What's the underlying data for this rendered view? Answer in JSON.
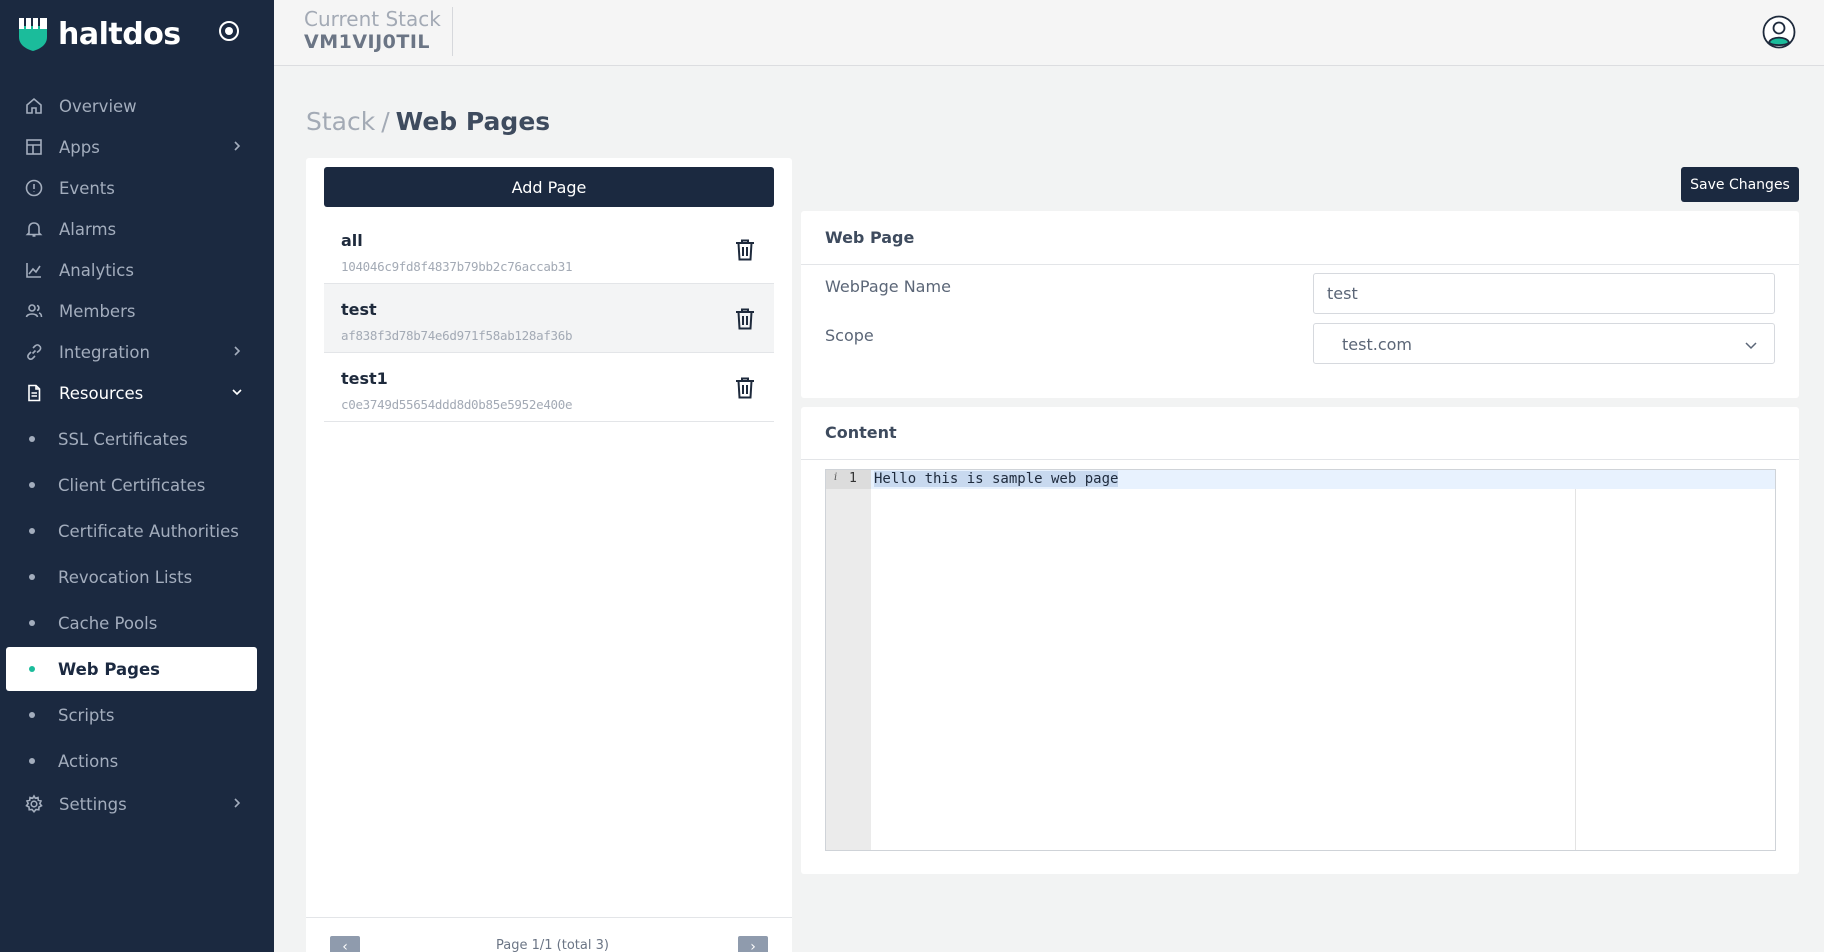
{
  "brand": {
    "name": "haltdos"
  },
  "topbar": {
    "stack_label": "Current Stack",
    "stack_value": "VM1VIJ0TIL"
  },
  "sidebar": {
    "items": [
      {
        "label": "Overview",
        "icon": "home-icon"
      },
      {
        "label": "Apps",
        "icon": "layout-icon"
      },
      {
        "label": "Events",
        "icon": "alert-circle-icon"
      },
      {
        "label": "Alarms",
        "icon": "bell-icon"
      },
      {
        "label": "Analytics",
        "icon": "chart-line-icon"
      },
      {
        "label": "Members",
        "icon": "users-icon"
      },
      {
        "label": "Integration",
        "icon": "link-icon"
      },
      {
        "label": "Resources",
        "icon": "document-icon"
      },
      {
        "label": "Settings",
        "icon": "gear-icon"
      }
    ],
    "resources_sub": [
      {
        "label": "SSL Certificates"
      },
      {
        "label": "Client Certificates"
      },
      {
        "label": "Certificate Authorities"
      },
      {
        "label": "Revocation Lists"
      },
      {
        "label": "Cache Pools"
      },
      {
        "label": "Web Pages"
      },
      {
        "label": "Scripts"
      },
      {
        "label": "Actions"
      }
    ]
  },
  "breadcrumb": {
    "root": "Stack",
    "separator": "/",
    "current": "Web Pages"
  },
  "list": {
    "add_label": "Add Page",
    "pages": [
      {
        "name": "all",
        "hash": "104046c9fd8f4837b79bb2c76accab31"
      },
      {
        "name": "test",
        "hash": "af838f3d78b74e6d971f58ab128af36b"
      },
      {
        "name": "test1",
        "hash": "c0e3749d55654ddd8d0b85e5952e400e"
      }
    ],
    "pagination": {
      "prev": "‹",
      "text": "Page 1/1 (total 3)",
      "next": "›"
    }
  },
  "save_label": "Save Changes",
  "webpage_card": {
    "title": "Web Page",
    "name_label": "WebPage Name",
    "name_value": "test",
    "scope_label": "Scope",
    "scope_value": "test.com"
  },
  "content_card": {
    "title": "Content",
    "line_number": "1",
    "gutter_marker": "i",
    "code": "Hello this is sample web page"
  },
  "colors": {
    "sidebar_bg": "#1b2940",
    "accent": "#1bbc9b",
    "button_bg": "#1b2940"
  }
}
